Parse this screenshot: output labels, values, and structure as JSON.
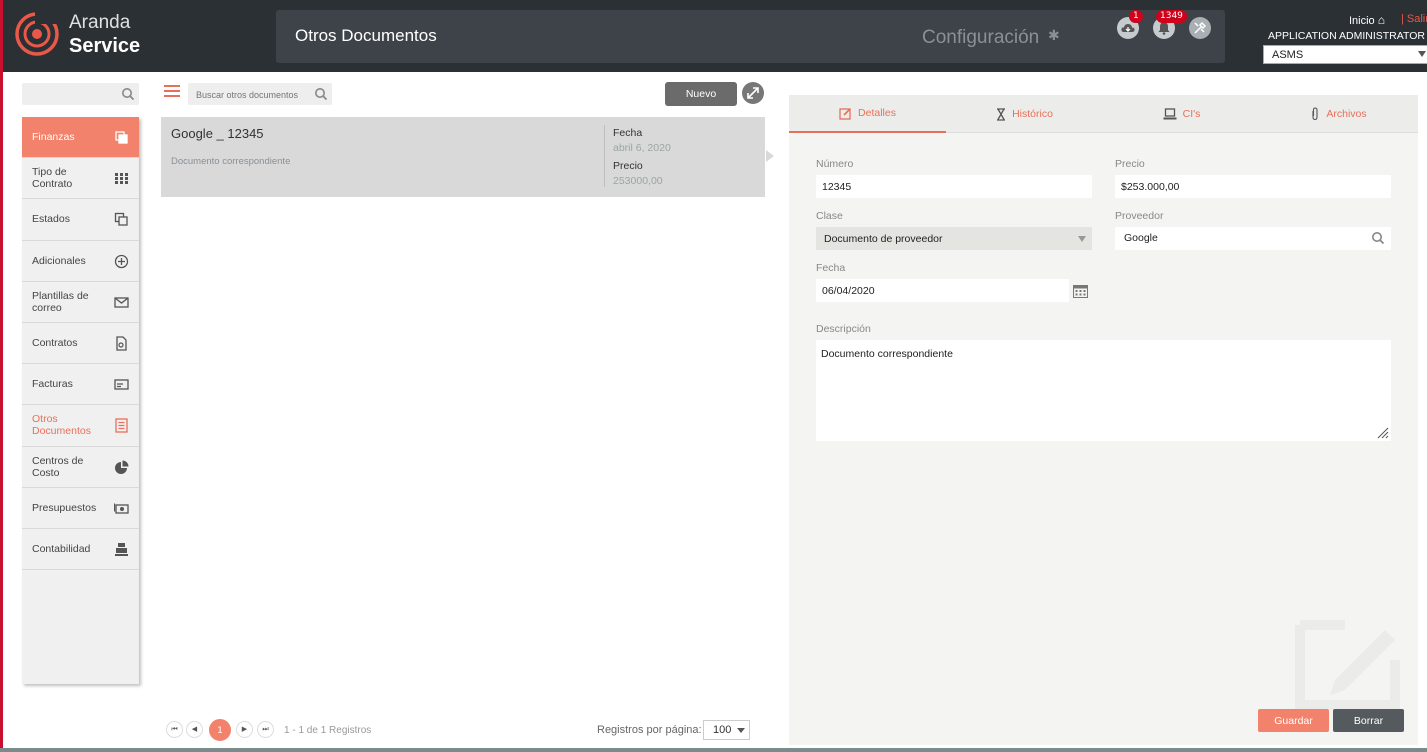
{
  "header": {
    "brand_line1": "Aranda",
    "brand_line2": "Service",
    "page_title": "Otros Documentos",
    "config_label": "Configuración",
    "cloud_badge": "1",
    "bell_badge": "1349",
    "inicio": "Inicio",
    "salir": "| Salir",
    "user_name": "APPLICATION ADMINISTRATOR",
    "tenant": "ASMS"
  },
  "sidebar": {
    "items": [
      {
        "label": "Finanzas",
        "icon": "copy-icon"
      },
      {
        "label": "Tipo de Contrato",
        "icon": "grid-icon"
      },
      {
        "label": "Estados",
        "icon": "copy-icon"
      },
      {
        "label": "Adicionales",
        "icon": "plus-circle-icon"
      },
      {
        "label": "Plantillas de correo",
        "icon": "mail-icon"
      },
      {
        "label": "Contratos",
        "icon": "document-icon"
      },
      {
        "label": "Facturas",
        "icon": "card-icon"
      },
      {
        "label": "Otros Documentos",
        "icon": "list-document-icon"
      },
      {
        "label": "Centros de Costo",
        "icon": "pie-icon"
      },
      {
        "label": "Presupuestos",
        "icon": "money-icon"
      },
      {
        "label": "Contabilidad",
        "icon": "register-icon"
      }
    ]
  },
  "list": {
    "search_placeholder": "Buscar otros documentos",
    "new_button": "Nuevo",
    "card": {
      "title": "Google _ 12345",
      "description": "Documento correspondiente",
      "date_label": "Fecha",
      "date_value": "abril 6, 2020",
      "price_label": "Precio",
      "price_value": "253000,00"
    },
    "pagination": {
      "current_page": "1",
      "info": "1 - 1 de 1 Registros",
      "per_page_label": "Registros por página:",
      "per_page_value": "100"
    }
  },
  "detail": {
    "tabs": [
      {
        "label": "Detalles",
        "icon": "edit-icon"
      },
      {
        "label": "Histórico",
        "icon": "hourglass-icon"
      },
      {
        "label": "CI's",
        "icon": "laptop-icon"
      },
      {
        "label": "Archivos",
        "icon": "paperclip-icon"
      }
    ],
    "numero_label": "Número",
    "numero_value": "12345",
    "precio_label": "Precio",
    "precio_value": "$253.000,00",
    "clase_label": "Clase",
    "clase_value": "Documento de proveedor",
    "proveedor_label": "Proveedor",
    "proveedor_value": "Google",
    "fecha_label": "Fecha",
    "fecha_value": "06/04/2020",
    "descripcion_label": "Descripción",
    "descripcion_value": "Documento correspondiente",
    "save_button": "Guardar",
    "delete_button": "Borrar"
  },
  "colors": {
    "accent": "#f2826b",
    "header_bg": "#2b3034",
    "badge": "#d0021b"
  }
}
